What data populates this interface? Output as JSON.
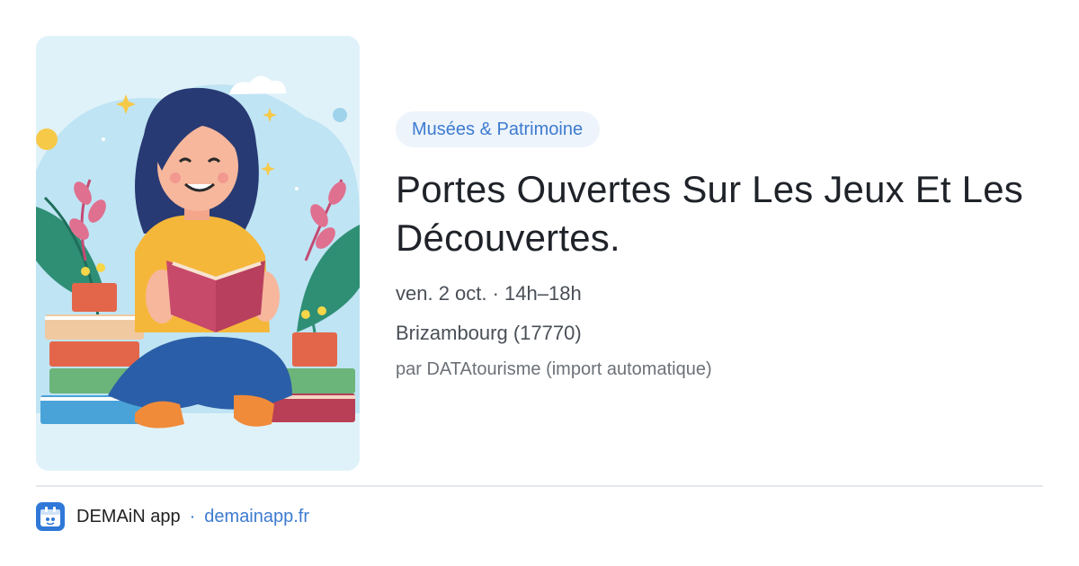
{
  "event": {
    "category": "Musées & Patrimoine",
    "title": "Portes Ouvertes Sur Les Jeux Et Les Découvertes.",
    "date_time": "ven. 2 oct. · 14h–18h",
    "location": "Brizambourg (17770)",
    "source": "par DATAtourisme (import automatique)",
    "illustration": "girl-reading-book-illustration"
  },
  "footer": {
    "app_name": "DEMAiN app",
    "separator": "·",
    "link": "demainapp.fr",
    "logo_icon": "app-logo-icon"
  },
  "colors": {
    "accent": "#3d7bcf",
    "category_bg": "#edf4fc",
    "title": "#1f2329",
    "logo_bg": "#2f78d8"
  }
}
